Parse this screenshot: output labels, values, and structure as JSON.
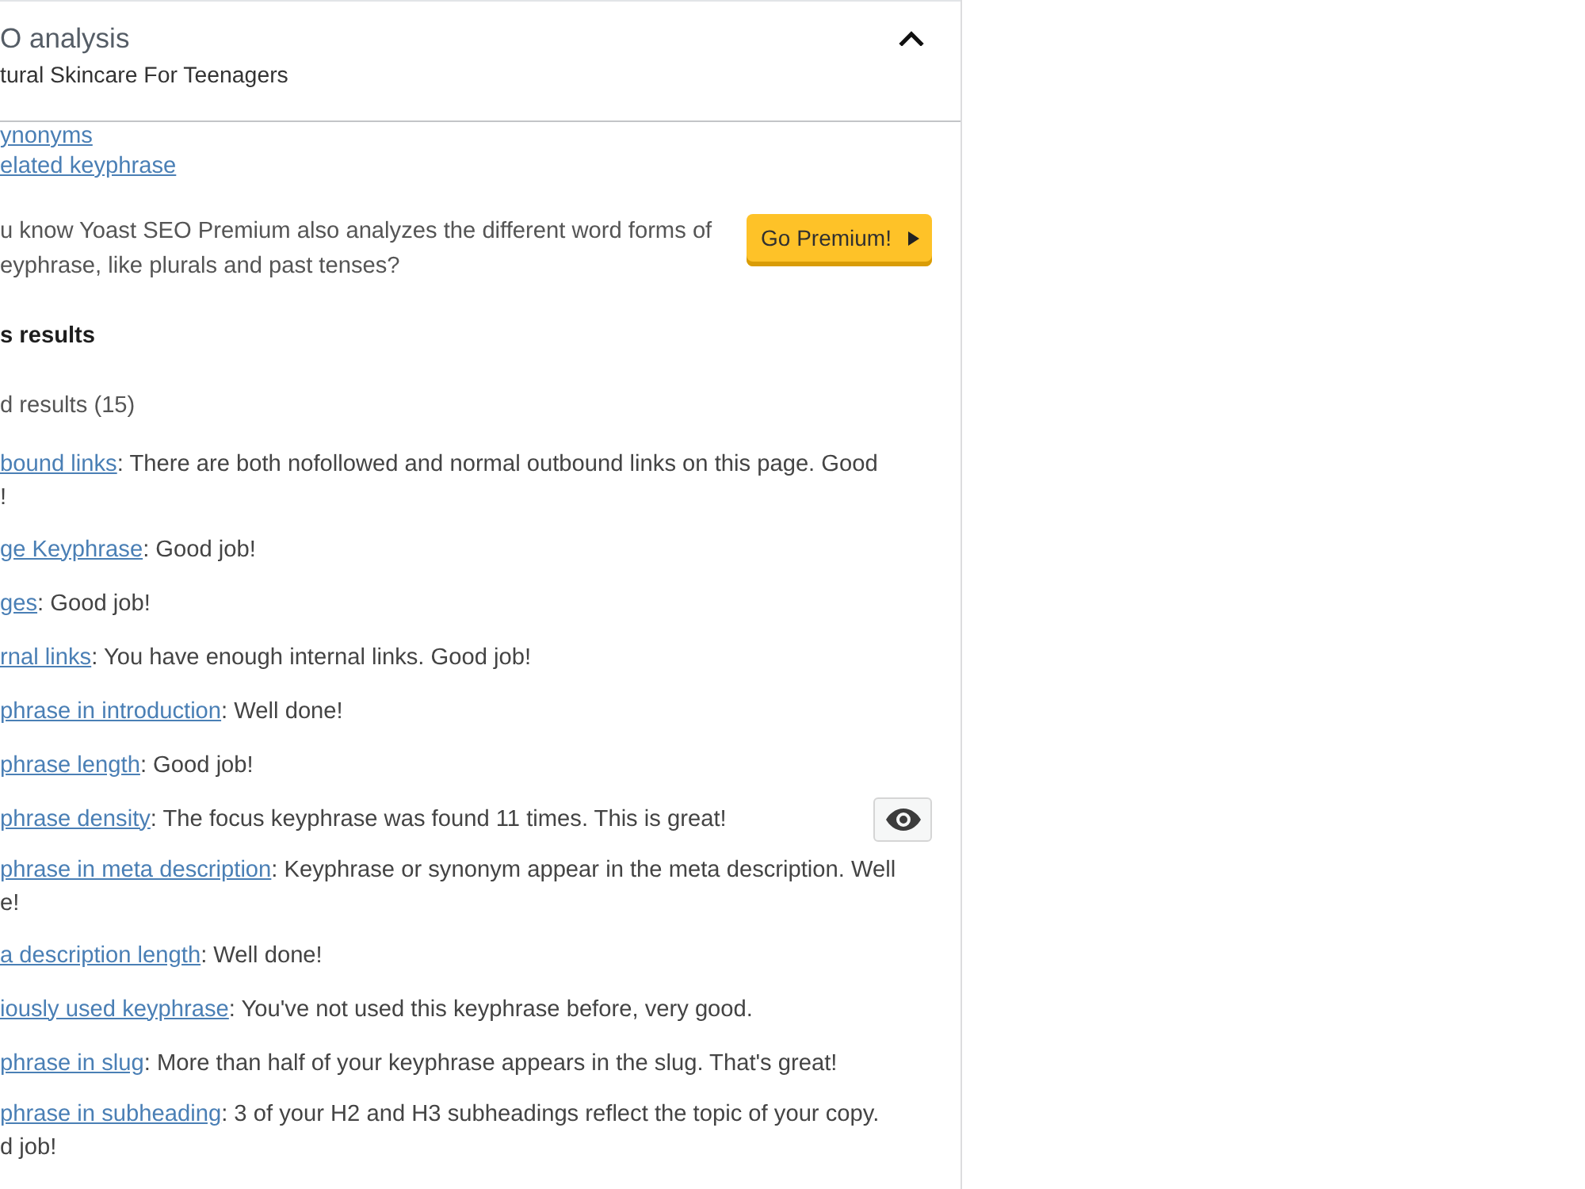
{
  "metabox": {
    "title": "O analysis",
    "subtitle": "tural Skincare For Teenagers",
    "expanded": true
  },
  "links": [
    "ynonyms",
    "elated keyphrase"
  ],
  "premium_notice": {
    "lines": [
      "u know Yoast SEO Premium also analyzes the different word forms of",
      "eyphrase, like plurals and past tenses?"
    ],
    "button": "Go Premium!"
  },
  "heading": "s results",
  "group": {
    "label": "d results (15)"
  },
  "results": [
    {
      "link": "bound links",
      "text": ": There are both nofollowed and normal outbound links on this page. Good",
      "continued": "!",
      "marker_button": false
    },
    {
      "link": "ge Keyphrase",
      "text": ": Good job!",
      "marker_button": false
    },
    {
      "link": "ges",
      "text": ": Good job!",
      "marker_button": false
    },
    {
      "link": "rnal links",
      "text": ": You have enough internal links. Good job!",
      "marker_button": false
    },
    {
      "link": "phrase in introduction",
      "text": ": Well done!",
      "marker_button": false
    },
    {
      "link": "phrase length",
      "text": ": Good job!",
      "marker_button": false
    },
    {
      "link": "phrase density",
      "text": ": The focus keyphrase was found 11 times. This is great!",
      "marker_button": true
    },
    {
      "link": "phrase in meta description",
      "text": ": Keyphrase or synonym appear in the meta description. Well",
      "continued": "e!",
      "marker_button": false
    },
    {
      "link": "a description length",
      "text": ": Well done!",
      "marker_button": false
    },
    {
      "link": "iously used keyphrase",
      "text": ": You've not used this keyphrase before, very good.",
      "marker_button": false
    },
    {
      "link": "phrase in slug",
      "text": ": More than half of your keyphrase appears in the slug. That's great!",
      "marker_button": false
    },
    {
      "link": "phrase in subheading",
      "text": ": 3 of your H2 and H3 subheadings reflect the topic of your copy.",
      "continued": "d job!",
      "marker_button": false
    }
  ]
}
